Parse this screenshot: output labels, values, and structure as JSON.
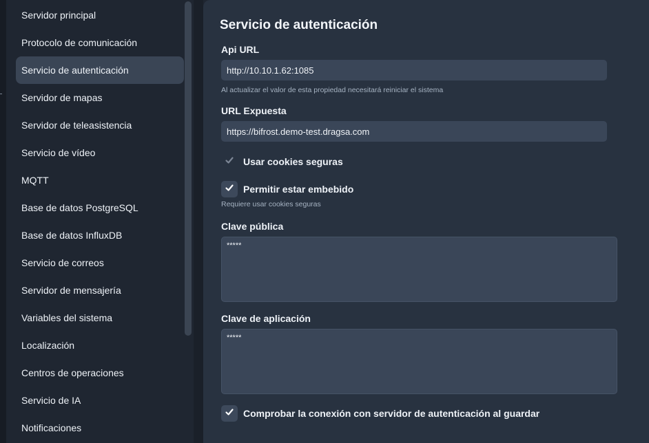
{
  "sidebar": {
    "items": [
      {
        "label": "Servidor principal",
        "active": false
      },
      {
        "label": "Protocolo de comunicación",
        "active": false
      },
      {
        "label": "Servicio de autenticación",
        "active": true
      },
      {
        "label": "Servidor de mapas",
        "active": false
      },
      {
        "label": "Servidor de teleasistencia",
        "active": false
      },
      {
        "label": "Servicio de vídeo",
        "active": false
      },
      {
        "label": "MQTT",
        "active": false
      },
      {
        "label": "Base de datos PostgreSQL",
        "active": false
      },
      {
        "label": "Base de datos InfluxDB",
        "active": false
      },
      {
        "label": "Servicio de correos",
        "active": false
      },
      {
        "label": "Servidor de mensajería",
        "active": false
      },
      {
        "label": "Variables del sistema",
        "active": false
      },
      {
        "label": "Localización",
        "active": false
      },
      {
        "label": "Centros de operaciones",
        "active": false
      },
      {
        "label": "Servicio de IA",
        "active": false
      },
      {
        "label": "Notificaciones",
        "active": false
      }
    ]
  },
  "panel": {
    "title": "Servicio de autenticación",
    "api_url": {
      "label": "Api URL",
      "value": "http://10.10.1.62:1085",
      "hint": "Al actualizar el valor de esta propiedad necesitará reiniciar el sistema"
    },
    "exposed_url": {
      "label": "URL Expuesta",
      "value": "https://bifrost.demo-test.dragsa.com"
    },
    "secure_cookies": {
      "label": "Usar cookies seguras",
      "checked": true,
      "disabled": true
    },
    "allow_embedded": {
      "label": "Permitir estar embebido",
      "checked": true,
      "hint": "Requiere usar cookies seguras"
    },
    "public_key": {
      "label": "Clave pública",
      "value": "*****"
    },
    "app_key": {
      "label": "Clave de aplicación",
      "value": "*****"
    },
    "check_connection": {
      "label": "Comprobar la conexión con servidor de autenticación al guardar",
      "checked": true
    }
  },
  "icons": {
    "check": "check-icon"
  },
  "colors": {
    "background": "#1f2631",
    "panel": "#283240",
    "input": "#3a4658",
    "active_item": "#3a4555",
    "hint_text": "#a6b3c2"
  }
}
